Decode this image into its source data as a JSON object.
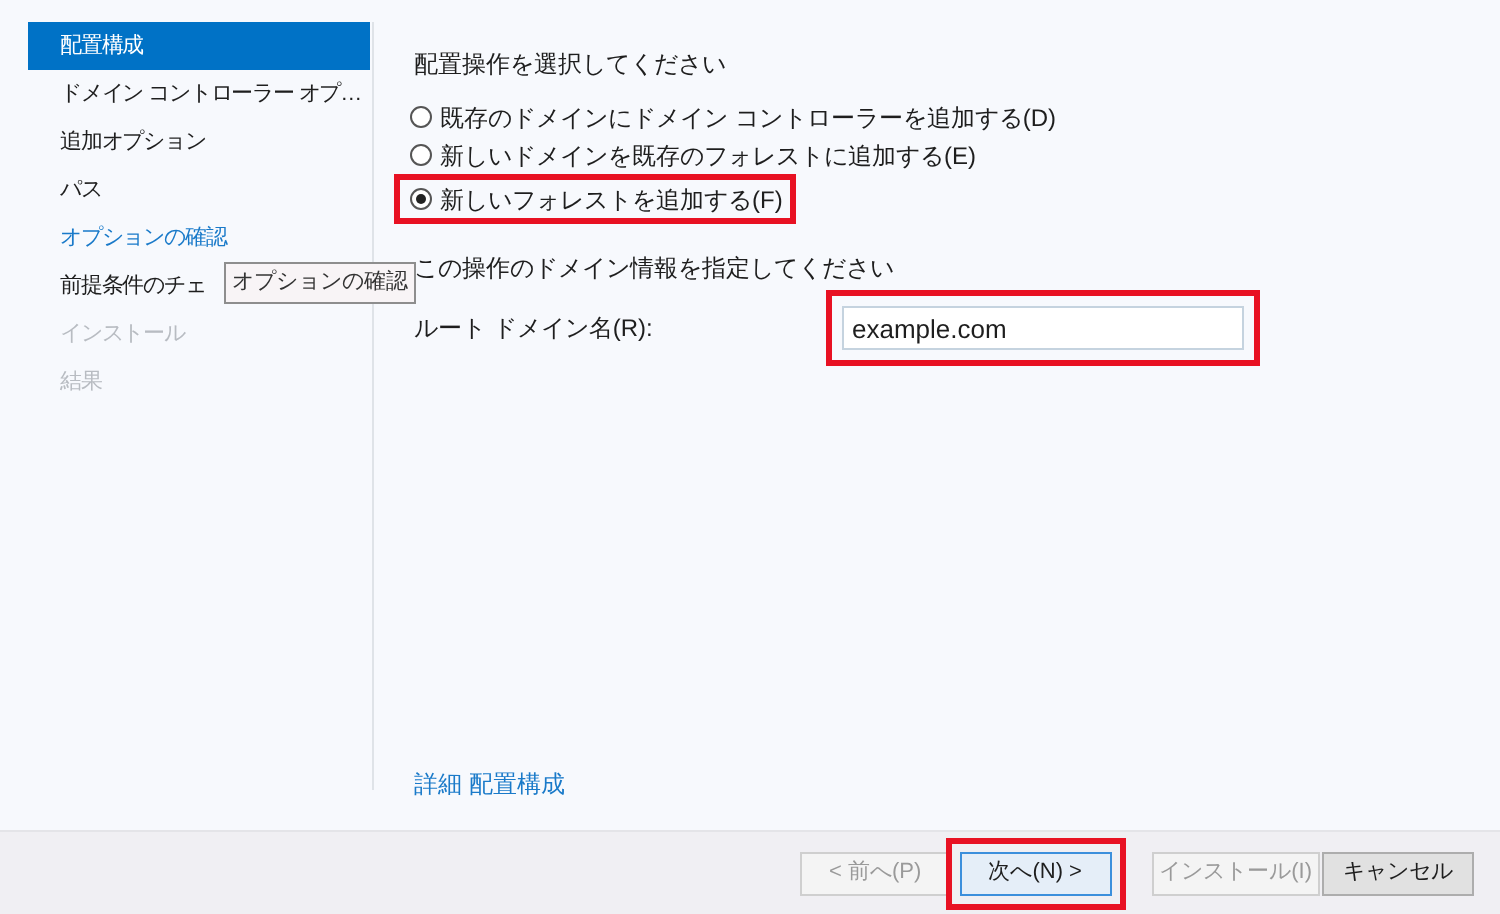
{
  "sidebar": {
    "items": [
      {
        "label": "配置構成",
        "selected": true,
        "hovered": false,
        "disabled": false
      },
      {
        "label": "ドメイン コントローラー オプ…",
        "selected": false,
        "hovered": false,
        "disabled": false
      },
      {
        "label": "追加オプション",
        "selected": false,
        "hovered": false,
        "disabled": false
      },
      {
        "label": "パス",
        "selected": false,
        "hovered": false,
        "disabled": false
      },
      {
        "label": "オプションの確認",
        "selected": false,
        "hovered": true,
        "disabled": false
      },
      {
        "label": "前提条件のチェ",
        "selected": false,
        "hovered": false,
        "disabled": false
      },
      {
        "label": "インストール",
        "selected": false,
        "hovered": false,
        "disabled": true
      },
      {
        "label": "結果",
        "selected": false,
        "hovered": false,
        "disabled": true
      }
    ],
    "tooltip": "オプションの確認"
  },
  "main": {
    "operation_heading": "配置操作を選択してください",
    "options": [
      {
        "label": "既存のドメインにドメイン コントローラーを追加する(D)",
        "selected": false,
        "highlighted": false
      },
      {
        "label": "新しいドメインを既存のフォレストに追加する(E)",
        "selected": false,
        "highlighted": false
      },
      {
        "label": "新しいフォレストを追加する(F)",
        "selected": true,
        "highlighted": true
      }
    ],
    "domain_heading": "この操作のドメイン情報を指定してください",
    "root_domain": {
      "label": "ルート ドメイン名(R):",
      "value": "example.com",
      "highlighted": true
    },
    "link": "詳細 配置構成"
  },
  "buttons": [
    {
      "label": "< 前へ(P)",
      "disabled": true,
      "default": false,
      "highlighted": false
    },
    {
      "label": "次へ(N) >",
      "disabled": false,
      "default": true,
      "highlighted": true
    },
    {
      "label": "インストール(I)",
      "disabled": true,
      "default": false,
      "highlighted": false
    },
    {
      "label": "キャンセル",
      "disabled": false,
      "default": false,
      "highlighted": false
    }
  ]
}
